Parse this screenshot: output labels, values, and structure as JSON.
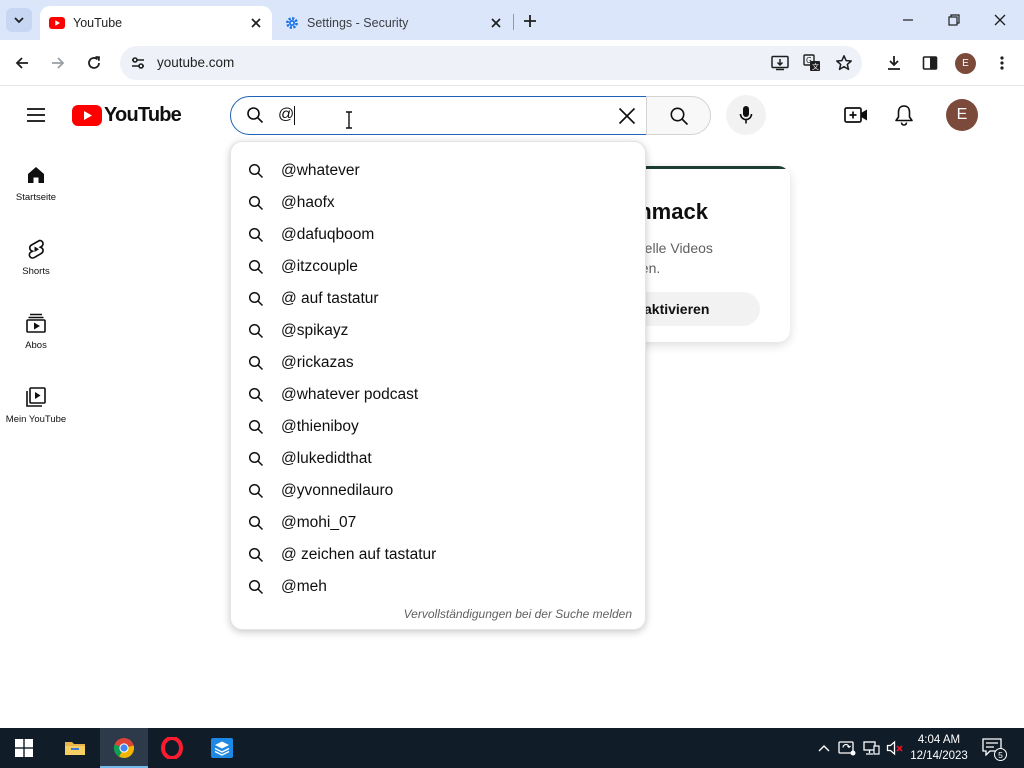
{
  "browser": {
    "tabs": [
      {
        "title": "YouTube",
        "active": true
      },
      {
        "title": "Settings - Security",
        "active": false
      }
    ],
    "address": {
      "url": "youtube.com"
    },
    "profile_initial": "E"
  },
  "youtube": {
    "logo_text": "YouTube",
    "search": {
      "query": "@",
      "report_text": "Vervollständigungen bei der Suche melden",
      "suggestions": [
        "@whatever",
        "@haofx",
        "@dafuqboom",
        "@itzcouple",
        "@ auf tastatur",
        "@spikayz",
        "@rickazas",
        "@whatever podcast",
        "@thieniboy",
        "@lukedidthat",
        "@yvonnedilauro",
        "@mohi_07",
        "@ zeichen auf tastatur",
        "@meh"
      ]
    },
    "avatar_initial": "E",
    "guide": [
      {
        "label": "Startseite",
        "icon": "home-icon"
      },
      {
        "label": "Shorts",
        "icon": "shorts-icon"
      },
      {
        "label": "Abos",
        "icon": "subscriptions-icon"
      },
      {
        "label": "Mein YouTube",
        "icon": "library-icon"
      }
    ],
    "promo": {
      "title_partial": "chmack",
      "line1_partial": "ktuelle Videos",
      "line2_partial": "chen.",
      "button_partial": "aktivieren"
    }
  },
  "taskbar": {
    "apps": [
      "start-icon",
      "file-explorer-icon",
      "chrome-icon",
      "opera-icon",
      "app-icon"
    ],
    "clock": {
      "time": "4:04 AM",
      "date": "12/14/2023"
    },
    "notification_count": "5"
  },
  "colors": {
    "yt_red": "#ff0000",
    "search_focus": "#1c62b9",
    "tabstrip": "#dbe6fb",
    "taskbar": "#101c28"
  }
}
